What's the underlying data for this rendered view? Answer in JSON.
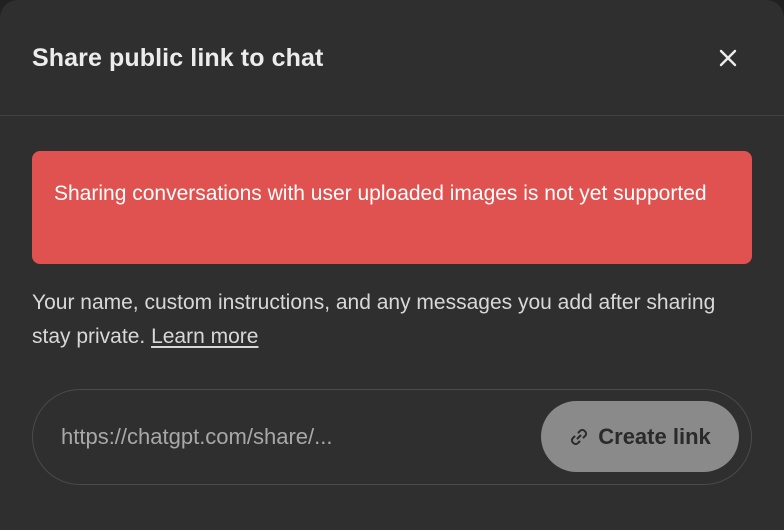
{
  "dialog": {
    "title": "Share public link to chat",
    "close_icon": "close-icon"
  },
  "alert": {
    "message": "Sharing conversations with user uploaded images is not yet supported",
    "color": "#e0524f"
  },
  "description": {
    "text": "Your name, custom instructions, and any messages you add after sharing stay private.",
    "learn_more_label": "Learn more"
  },
  "share_link": {
    "url_text": "https://chatgpt.com/share/...",
    "button_label": "Create link",
    "button_icon": "link-icon"
  }
}
